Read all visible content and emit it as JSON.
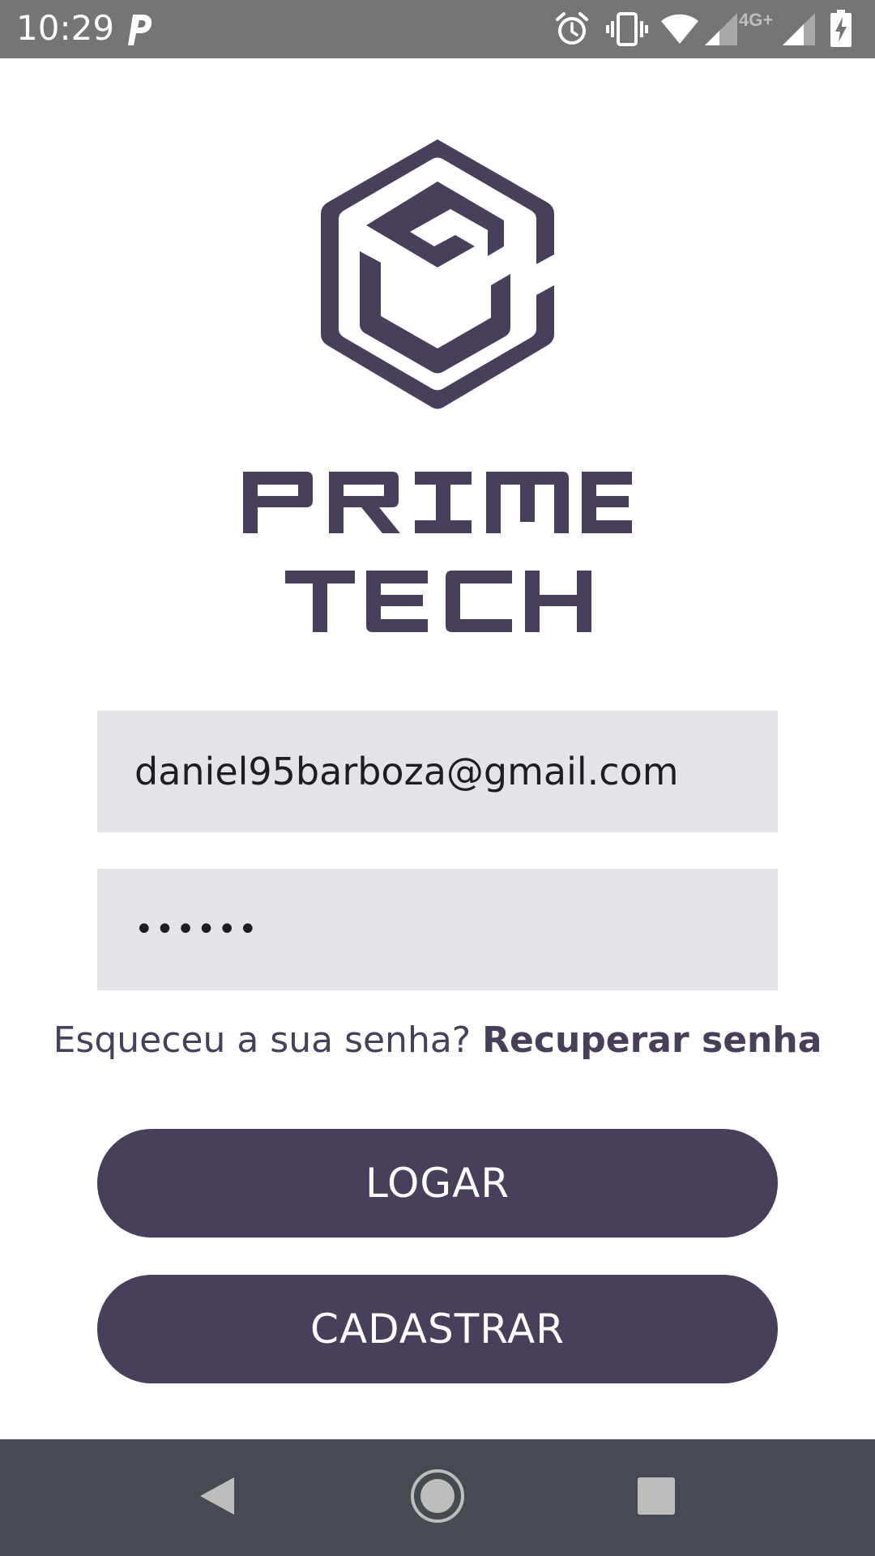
{
  "status_bar": {
    "time": "10:29",
    "icons": [
      "parking-icon",
      "alarm-icon",
      "vibrate-icon",
      "wifi-icon",
      "signal-icon",
      "signal-4g-icon",
      "battery-charging-icon"
    ],
    "network_label": "4G+"
  },
  "logo": {
    "icon": "primetech-cube-logo",
    "brand_line1": "PRIME",
    "brand_line2": "TECH",
    "color": "#48405a"
  },
  "form": {
    "email_value": "daniel95barboza@gmail.com",
    "password_value": "••••••",
    "forgot_text": "Esqueceu a sua senha? ",
    "recover_link": "Recuperar senha"
  },
  "buttons": {
    "login_label": "LOGAR",
    "register_label": "CADASTRAR"
  },
  "nav_bar": {
    "icons": [
      "back-icon",
      "home-icon",
      "recents-icon"
    ]
  },
  "colors": {
    "primary": "#483f5a",
    "field_background": "#e4e3e8",
    "status_bar": "#757575",
    "nav_bar": "#464b51"
  }
}
